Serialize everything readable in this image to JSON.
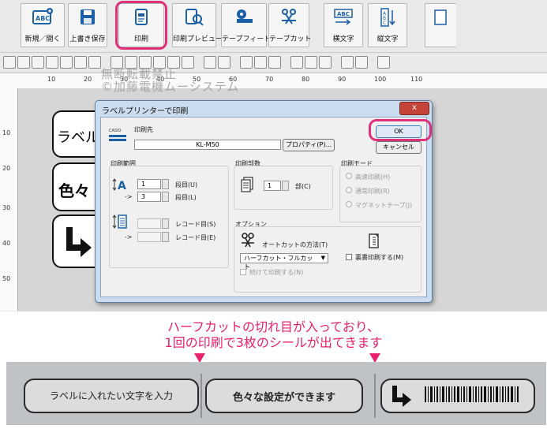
{
  "toolbar": {
    "buttons": [
      {
        "label": "新規／開く"
      },
      {
        "label": "上書き保存"
      },
      {
        "label": "印刷"
      },
      {
        "label": "印刷プレビュー"
      },
      {
        "label": "テープフィード"
      },
      {
        "label": "テープカット"
      },
      {
        "label": "横文字"
      },
      {
        "label": "縦文字"
      }
    ]
  },
  "ruler": {
    "watermark": "無断転載禁止\n©加藤電機ムーシステム",
    "ticks": [
      "10",
      "20",
      "30",
      "40",
      "50",
      "60",
      "70",
      "80",
      "90",
      "100",
      "110"
    ],
    "vticks": [
      "10",
      "20",
      "30",
      "40",
      "50"
    ]
  },
  "labels": {
    "first": "ラベル",
    "second": "色々"
  },
  "dialog": {
    "title": "ラベルプリンターで印刷",
    "close": "x",
    "brand": "CASIO",
    "printer_label": "印刷先",
    "printer_name": "KL-M50",
    "properties_button": "プロパティ(P)...",
    "ok_button": "OK",
    "cancel_button": "キャンセル",
    "range": {
      "title": "印刷範囲",
      "from_value": "1",
      "from_label": "段目(U)",
      "arrow": "->",
      "to_value": "3",
      "to_label": "段目(L)",
      "record_from_label": "レコード目(S)",
      "record_to_label": "レコード目(E)"
    },
    "copies": {
      "title": "印刷部数",
      "value": "1",
      "unit": "部(C)"
    },
    "mode": {
      "title": "印刷モード",
      "options": [
        "高速印刷(H)",
        "通常印刷(R)",
        "マグネットテープ(J)"
      ]
    },
    "options": {
      "title": "オプション",
      "autocut_label": "オートカットの方法(T)",
      "autocut_value": "ハーフカット・フルカット",
      "continuous_label": "続けて印刷する(N)",
      "mirror_label": "裏書印刷する(M)"
    }
  },
  "caption": {
    "line1": "ハーフカットの切れ目が入っており、",
    "line2": "1回の印刷で3枚のシールが出てきます"
  },
  "stickers": {
    "s1": "ラベルに入れたい文字を入力",
    "s2": "色々な設定ができます"
  },
  "colors": {
    "highlight": "#e0307a",
    "caption": "#e8206e"
  }
}
